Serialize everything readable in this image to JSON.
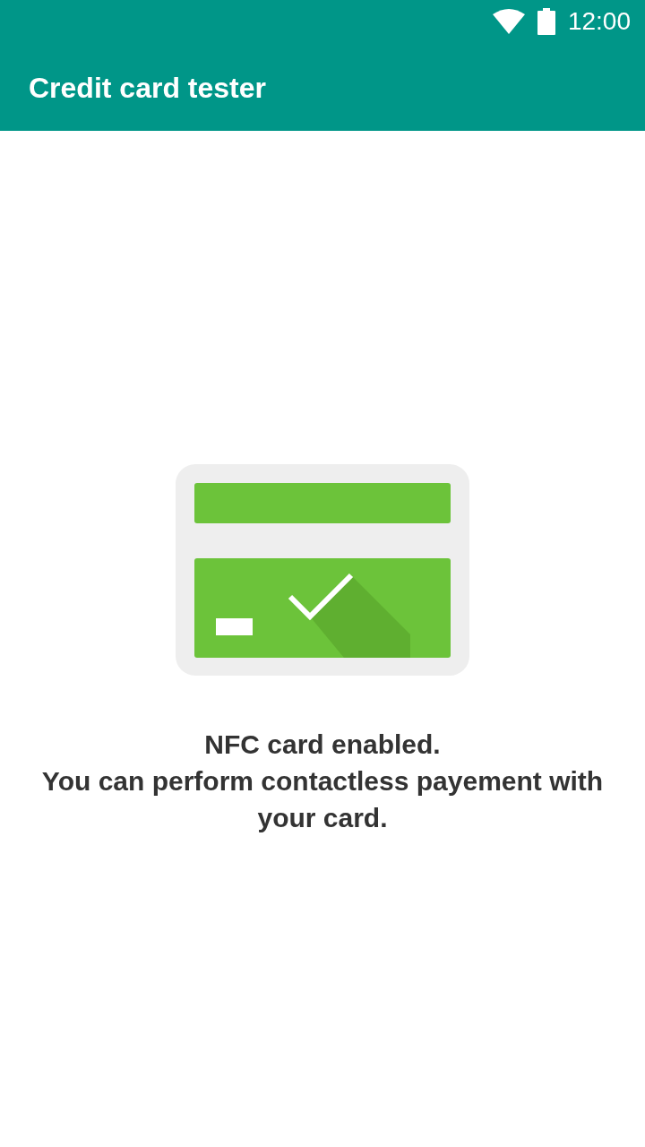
{
  "status_bar": {
    "time": "12:00"
  },
  "app_bar": {
    "title": "Credit card tester"
  },
  "message": {
    "lines": [
      "NFC card enabled.",
      "You can perform contactless payement with your card."
    ]
  }
}
